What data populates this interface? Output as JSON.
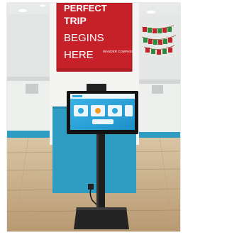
{
  "poster": {
    "line1": "PERFECT",
    "line2": "TRIP",
    "line3": "BEGINS",
    "line4": "HERE",
    "brand": "WANDER COMPASS"
  },
  "banner": {
    "letters": [
      "H",
      "A",
      "P",
      "P",
      "Y",
      "H",
      "O",
      "L",
      "I",
      "D",
      "A",
      "Y",
      "S"
    ]
  },
  "colors": {
    "poster_red": "#c62128",
    "wall_teal": "#2f9cc1",
    "kiosk_screen": "#2aa8e0",
    "floor_wood": "#cdb48f"
  }
}
